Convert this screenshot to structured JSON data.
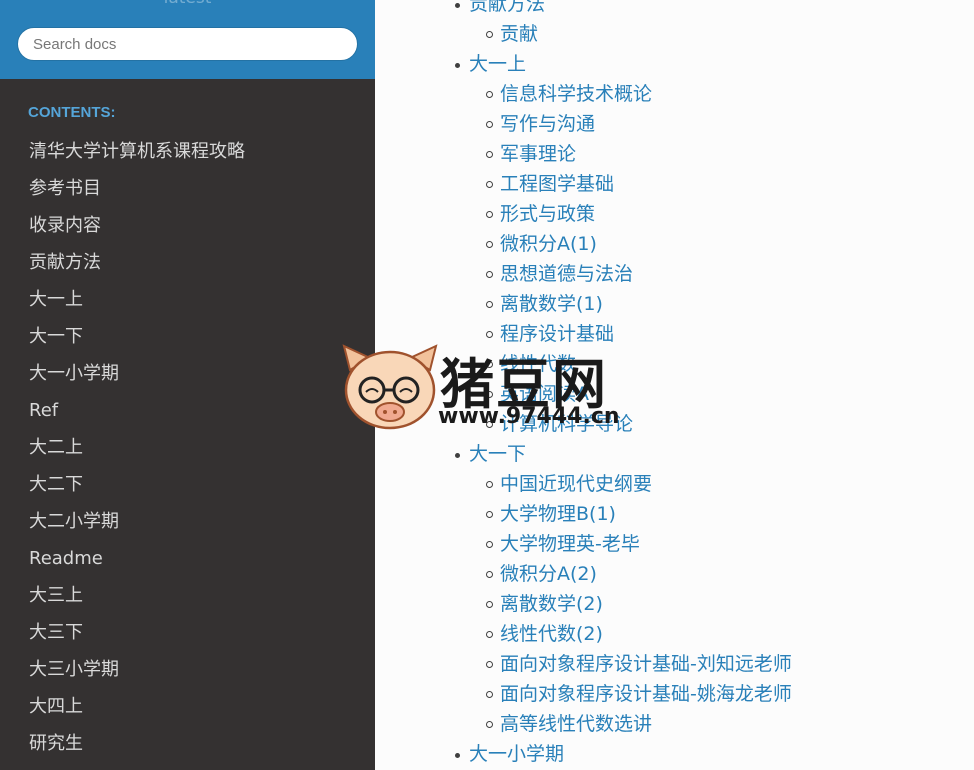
{
  "sidebar": {
    "version": "latest",
    "search_placeholder": "Search docs",
    "caption": "CONTENTS:",
    "items": [
      "清华大学计算机系课程攻略",
      "参考书目",
      "收录内容",
      "贡献方法",
      "大一上",
      "大一下",
      "大一小学期",
      "Ref",
      "大二上",
      "大二下",
      "大二小学期",
      "Readme",
      "大三上",
      "大三下",
      "大三小学期",
      "大四上",
      "研究生"
    ]
  },
  "toc": {
    "s1": {
      "label": "贡献方法",
      "children": [
        "贡献"
      ]
    },
    "s2": {
      "label": "大一上",
      "children": [
        "信息科学技术概论",
        "写作与沟通",
        "军事理论",
        "工程图学基础",
        "形式与政策",
        "微积分A(1)",
        "思想道德与法治",
        "离散数学(1)",
        "程序设计基础",
        "线性代数",
        "英语阅读A",
        "计算机科学导论"
      ]
    },
    "s3": {
      "label": "大一下",
      "children": [
        "中国近现代史纲要",
        "大学物理B(1)",
        "大学物理英-老毕",
        "微积分A(2)",
        "离散数学(2)",
        "线性代数(2)",
        "面向对象程序设计基础-刘知远老师",
        "面向对象程序设计基础-姚海龙老师",
        "高等线性代数选讲"
      ]
    },
    "s4": {
      "label": "大一小学期"
    }
  },
  "watermark": {
    "title": "猪豆网",
    "url": "www.97444.cn"
  },
  "colors": {
    "sidebar_bg": "#343131",
    "search_bg": "#2980b9",
    "link": "#2980b9",
    "caption": "#55a5d9"
  }
}
